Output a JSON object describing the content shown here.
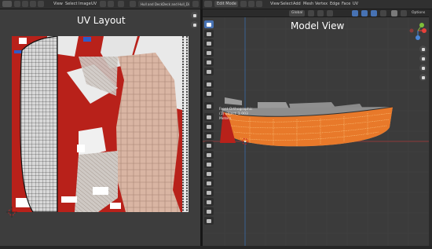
{
  "uv_editor": {
    "menu": [
      "View",
      "Select",
      "Image",
      "UV"
    ],
    "image_name": "Hull and DeckDeck and Hull_Diffuse",
    "overlay_title": "UV Layout"
  },
  "viewport": {
    "mode": "Edit Mode",
    "menu": [
      "View",
      "Select",
      "Add",
      "Mesh",
      "Vertex",
      "Edge",
      "Face",
      "UV"
    ],
    "transform_orientation": "Global",
    "options_label": "Options",
    "overlay_title": "Model View",
    "info_lines": [
      "Front Orthographic",
      "(1) object_1.003",
      "Meters"
    ]
  },
  "colors": {
    "accent": "#4772b3",
    "texture_red": "#b8211a",
    "mesh_orange": "#e8792a",
    "axis_x": "#e8413a",
    "axis_y": "#7fbf3a",
    "axis_z": "#4a86d8"
  },
  "icons": {
    "uv_tools": [
      "zoom-icon",
      "pan-icon"
    ],
    "viewport_tools": [
      "select-box-icon",
      "cursor-icon",
      "move-icon",
      "rotate-icon",
      "scale-icon",
      "transform-icon",
      "annotate-icon",
      "measure-icon",
      "add-cube-icon",
      "extrude-icon",
      "inset-icon",
      "bevel-icon",
      "loop-cut-icon",
      "knife-icon",
      "poly-build-icon",
      "spin-icon",
      "smooth-icon",
      "edge-slide-icon",
      "shrink-icon",
      "shear-icon",
      "rip-icon"
    ]
  }
}
